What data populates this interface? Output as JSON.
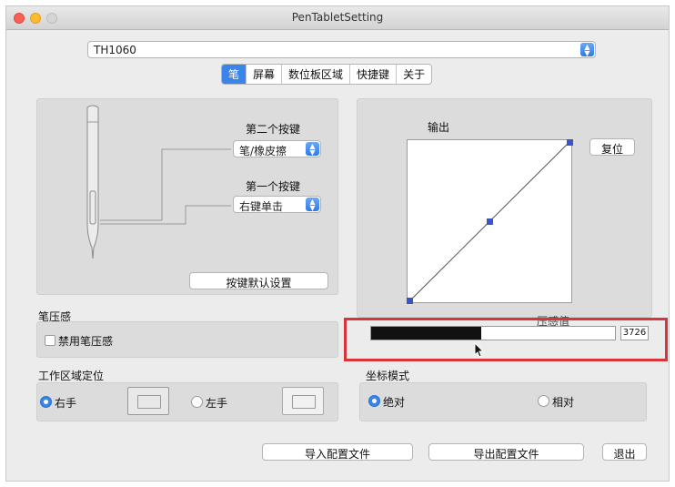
{
  "window": {
    "title": "PenTabletSetting"
  },
  "device": {
    "selected": "TH1060"
  },
  "tabs": [
    {
      "label": "笔",
      "active": true
    },
    {
      "label": "屏幕",
      "active": false
    },
    {
      "label": "数位板区域",
      "active": false
    },
    {
      "label": "快捷键",
      "active": false
    },
    {
      "label": "关于",
      "active": false
    }
  ],
  "pen": {
    "second_button_label": "第二个按键",
    "second_button_value": "笔/橡皮擦",
    "first_button_label": "第一个按键",
    "first_button_value": "右键单击",
    "default_button_label": "按键默认设置"
  },
  "pressure": {
    "group_label": "笔压感",
    "disable_label": "禁用笔压感",
    "disable_checked": false
  },
  "curve": {
    "output_label": "输出",
    "reset_label": "复位",
    "sensitivity_label": "压感值",
    "pressure_value": "3726",
    "pressure_bar_fraction": 0.45
  },
  "workarea": {
    "group_label": "工作区域定位",
    "right_hand": "右手",
    "left_hand": "左手",
    "selected": "右手"
  },
  "coords": {
    "group_label": "坐标模式",
    "absolute": "绝对",
    "relative": "相对",
    "selected": "绝对"
  },
  "footer": {
    "import_label": "导入配置文件",
    "export_label": "导出配置文件",
    "exit_label": "退出"
  },
  "colors": {
    "accent": "#3a84ea",
    "highlight_box": "#d8353b",
    "bar_fill": "#111111"
  }
}
